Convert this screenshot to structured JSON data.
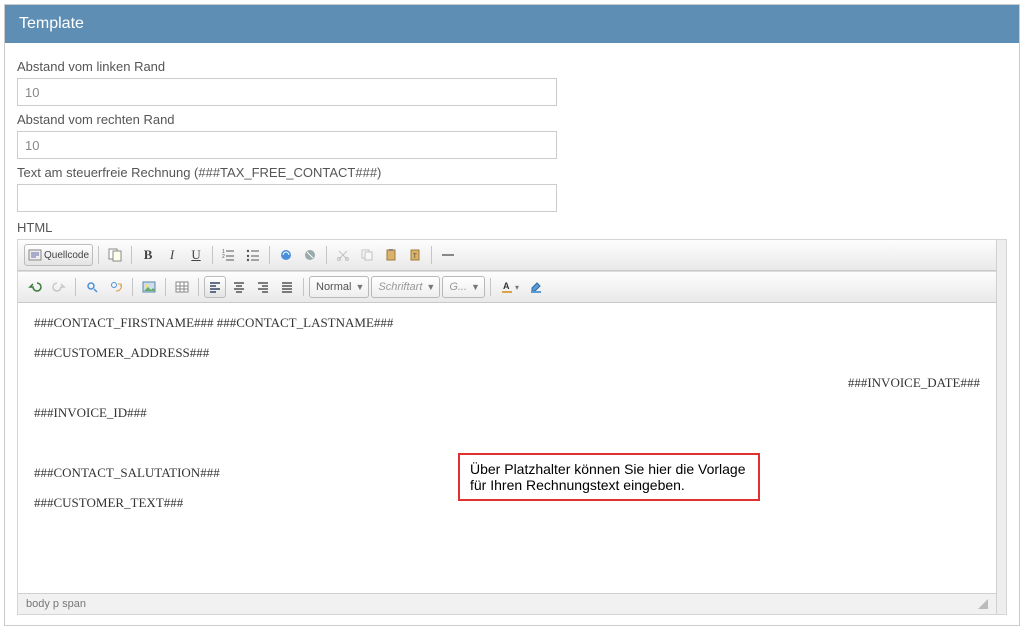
{
  "header": {
    "title": "Template"
  },
  "form": {
    "left_margin_label": "Abstand vom linken Rand",
    "left_margin_value": "10",
    "right_margin_label": "Abstand vom rechten Rand",
    "right_margin_value": "10",
    "tax_free_label": "Text am steuerfreie Rechnung (###TAX_FREE_CONTACT###)",
    "tax_free_value": "",
    "html_label": "HTML"
  },
  "toolbar": {
    "source_label": "Quellcode",
    "bold_glyph": "B",
    "italic_glyph": "I",
    "underline_glyph": "U",
    "combo_format": "Normal",
    "combo_font": "Schriftart",
    "combo_size": "G..."
  },
  "editor": {
    "line1": "###CONTACT_FIRSTNAME### ###CONTACT_LASTNAME###",
    "line2": "###CUSTOMER_ADDRESS###",
    "line3_right": "###INVOICE_DATE###",
    "line4": "###INVOICE_ID###",
    "line5": "###CONTACT_SALUTATION###",
    "line6": "###CUSTOMER_TEXT###"
  },
  "callout": {
    "text": "Über Platzhalter können Sie hier die Vorlage für Ihren Rechnungstext eingeben."
  },
  "status": {
    "path": "body  p  span"
  }
}
